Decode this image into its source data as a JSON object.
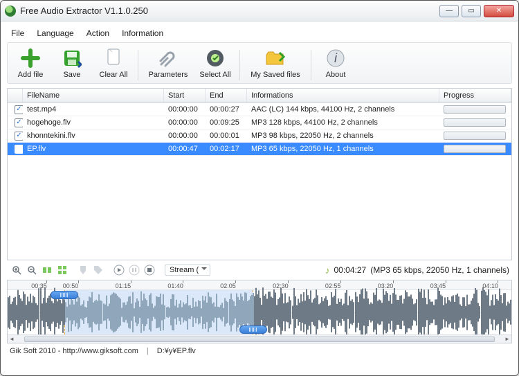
{
  "window": {
    "title": "Free Audio Extractor V1.1.0.250"
  },
  "menu": {
    "file": "File",
    "language": "Language",
    "action": "Action",
    "information": "Information"
  },
  "toolbar": {
    "add_file": "Add file",
    "save": "Save",
    "clear_all": "Clear All",
    "parameters": "Parameters",
    "select_all": "Select All",
    "my_saved_files": "My Saved files",
    "about": "About"
  },
  "columns": {
    "filename": "FileName",
    "start": "Start",
    "end": "End",
    "info": "Informations",
    "progress": "Progress"
  },
  "rows": [
    {
      "checked": true,
      "selected": false,
      "filename": "test.mp4",
      "start": "00:00:00",
      "end": "00:00:27",
      "info": "AAC (LC) 144 kbps, 44100 Hz, 2 channels"
    },
    {
      "checked": true,
      "selected": false,
      "filename": "hogehoge.flv",
      "start": "00:00:00",
      "end": "00:09:25",
      "info": "MP3 128 kbps, 44100 Hz, 2 channels"
    },
    {
      "checked": true,
      "selected": false,
      "filename": "khonntekini.flv",
      "start": "00:00:00",
      "end": "00:00:01",
      "info": "MP3 98 kbps, 22050 Hz, 2 channels"
    },
    {
      "checked": true,
      "selected": true,
      "filename": "EP.flv",
      "start": "00:00:47",
      "end": "00:02:17",
      "info": "MP3 65 kbps, 22050 Hz, 1 channels"
    }
  ],
  "wave": {
    "stream_label": "Stream (",
    "duration": "00:04:27",
    "codec": "(MP3 65 kbps, 22050 Hz, 1 channels)",
    "sel_start": "00:00:47",
    "sel_end": "00:02:17",
    "ticks": [
      "00:35",
      "00:50",
      "01:15",
      "01:40",
      "02:05",
      "02:30",
      "02:55",
      "03:20",
      "03:45",
      "04:10"
    ]
  },
  "status": {
    "left": "Gik Soft 2010 - http://www.giksoft.com",
    "right": "D:¥y¥EP.flv"
  }
}
